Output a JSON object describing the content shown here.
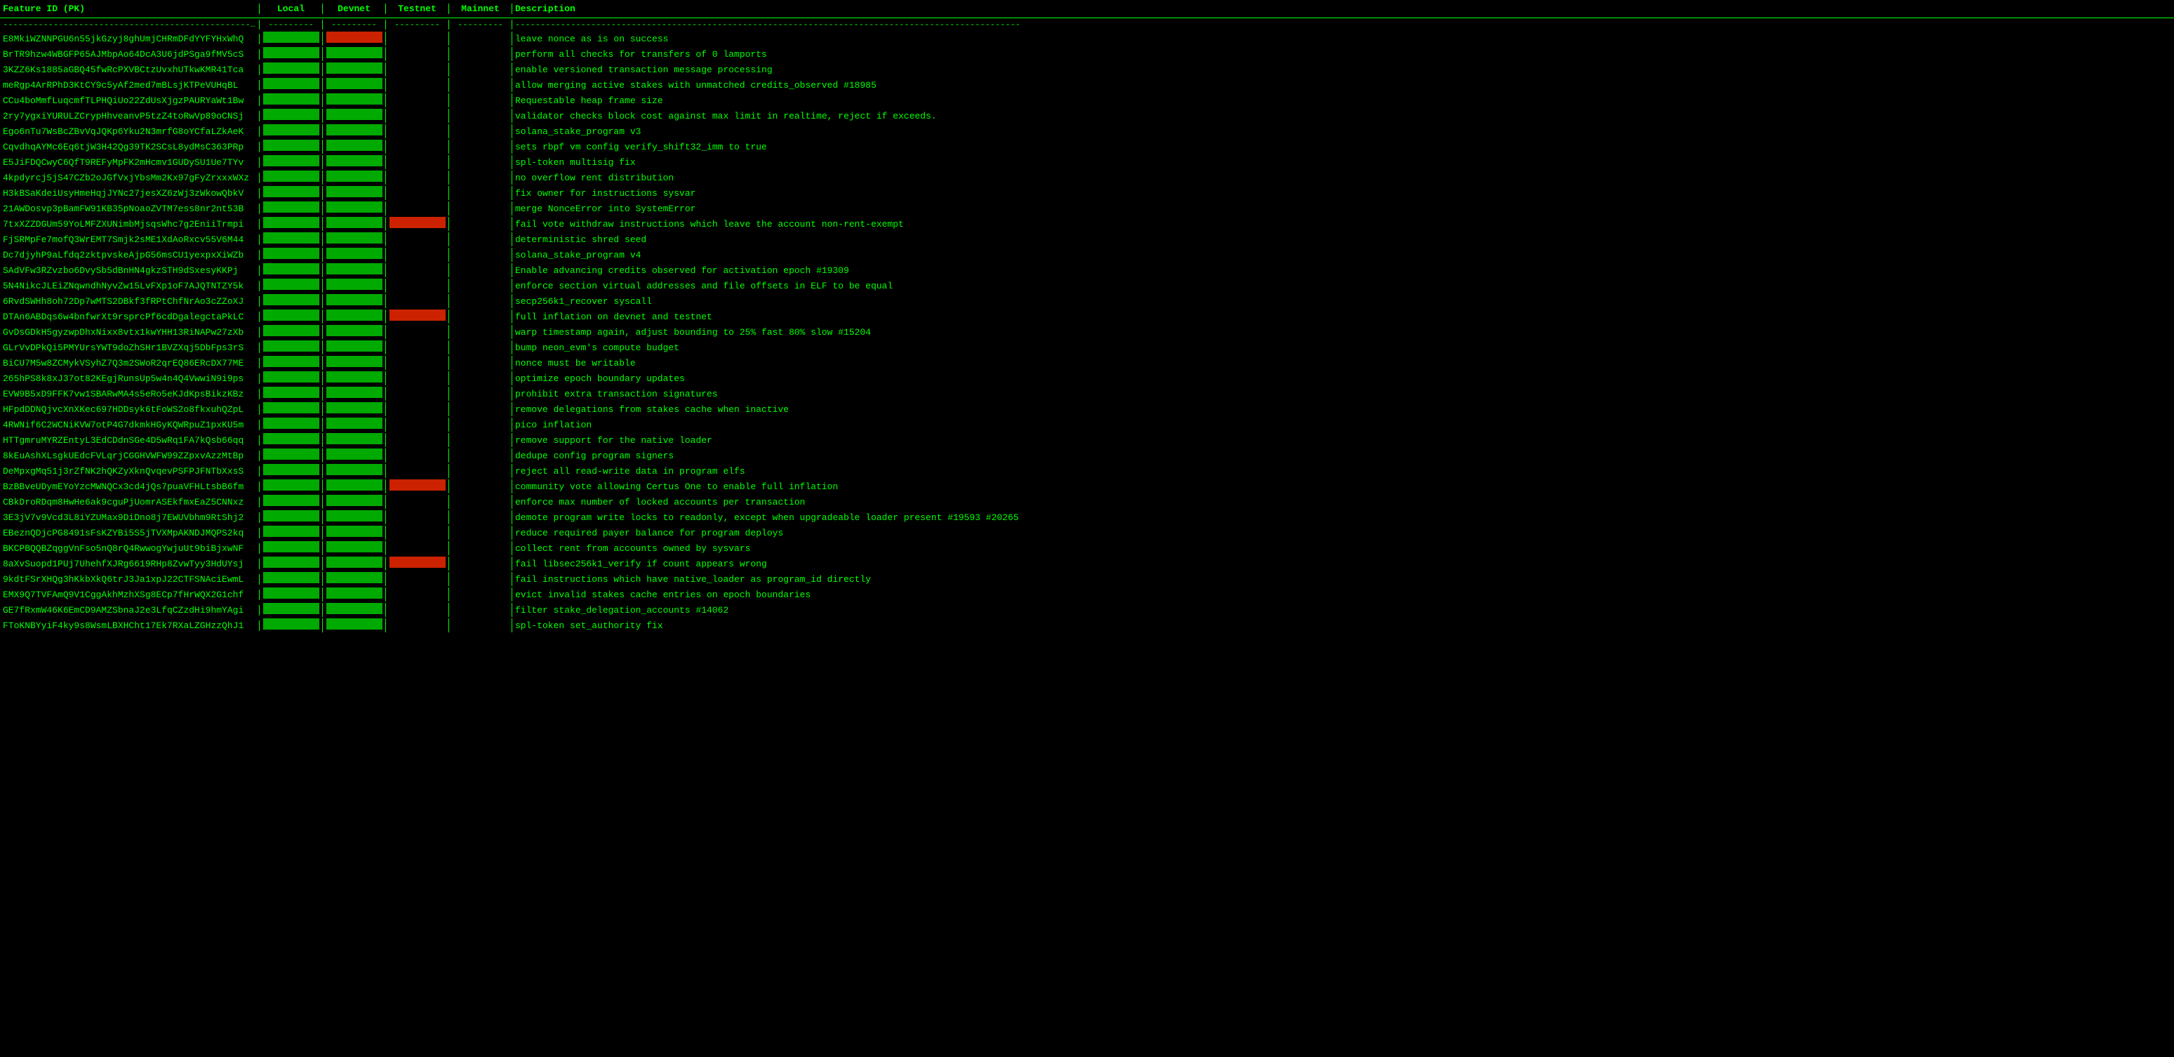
{
  "header": {
    "col_feature": "Feature ID (PK)",
    "col_local": "Local",
    "col_devnet": "Devnet",
    "col_testnet": "Testnet",
    "col_mainnet": "Mainnet",
    "col_description": "Description"
  },
  "rows": [
    {
      "id": "E8MkiWZNNPGU6n55jkGzyj8ghUmjCHRmDFdYYFYHxWhQ",
      "local": "green",
      "devnet": "red",
      "testnet": "empty",
      "mainnet": "empty",
      "desc": "leave nonce as is on success"
    },
    {
      "id": "BrTR9hzw4WBGFP65AJMbpAo64DcA3U6jdPSga9fMV5cS",
      "local": "green",
      "devnet": "green",
      "testnet": "empty",
      "mainnet": "empty",
      "desc": "perform all checks for transfers of 0 lamports"
    },
    {
      "id": "3KZZ6Ks1885aGBQ45fwRcPXVBCtzUvxhUTkwKMR41Tca",
      "local": "green",
      "devnet": "green",
      "testnet": "empty",
      "mainnet": "empty",
      "desc": "enable versioned transaction message processing"
    },
    {
      "id": "meRgp4ArRPhD3KtCY9c5yAf2med7mBLsjKTPeVUHqBL",
      "local": "green",
      "devnet": "green",
      "testnet": "empty",
      "mainnet": "empty",
      "desc": "allow merging active stakes with unmatched credits_observed #18985"
    },
    {
      "id": "CCu4boMmfLuqcmfTLPHQiUo22ZdUsXjgzPAURYaWt1Bw",
      "local": "green",
      "devnet": "green",
      "testnet": "empty",
      "mainnet": "empty",
      "desc": "Requestable heap frame size"
    },
    {
      "id": "2ry7ygxiYURULZCrypHhveanvP5tzZ4toRwVp89oCNSj",
      "local": "green",
      "devnet": "green",
      "testnet": "empty",
      "mainnet": "empty",
      "desc": "validator checks block cost against max limit in realtime, reject if exceeds."
    },
    {
      "id": "Ego6nTu7WsBcZBvVqJQKp6Yku2N3mrfG8oYCfaLZkAeK",
      "local": "green",
      "devnet": "green",
      "testnet": "empty",
      "mainnet": "empty",
      "desc": "solana_stake_program v3"
    },
    {
      "id": "CqvdhqAYMc6Eq6tjW3H42Qg39TK2SCsL8ydMsC363PRp",
      "local": "green",
      "devnet": "green",
      "testnet": "empty",
      "mainnet": "empty",
      "desc": "sets rbpf vm config verify_shift32_imm to true"
    },
    {
      "id": "E5JiFDQCwyC6QfT9REFyMpFK2mHcmv1GUDySU1Ue7TYv",
      "local": "green",
      "devnet": "green",
      "testnet": "empty",
      "mainnet": "empty",
      "desc": "spl-token multisig fix"
    },
    {
      "id": "4kpdyrcj5jS47CZb2oJGfVxjYbsMm2Kx97gFyZrxxxWXz",
      "local": "green",
      "devnet": "green",
      "testnet": "empty",
      "mainnet": "empty",
      "desc": "no overflow rent distribution"
    },
    {
      "id": "H3kBSaKdeiUsyHmeHqjJYNc27jesXZ6zWj3zWkowQbkV",
      "local": "green",
      "devnet": "green",
      "testnet": "empty",
      "mainnet": "empty",
      "desc": "fix owner for instructions sysvar"
    },
    {
      "id": "21AWDosvp3pBamFW91KB35pNoaoZVTM7ess8nr2nt53B",
      "local": "green",
      "devnet": "green",
      "testnet": "empty",
      "mainnet": "empty",
      "desc": "merge NonceError into SystemError"
    },
    {
      "id": "7txXZZDGUm59YoLMFZXUNimbMjsqsWhc7g2EniiTrmpi",
      "local": "green",
      "devnet": "green",
      "testnet": "red",
      "mainnet": "empty",
      "desc": "fail vote withdraw instructions which leave the account non-rent-exempt"
    },
    {
      "id": "FjSRMpFe7mofQ3WrEMT7Smjk2sME1XdAoRxcv55V6M44",
      "local": "green",
      "devnet": "green",
      "testnet": "empty",
      "mainnet": "empty",
      "desc": "deterministic shred seed"
    },
    {
      "id": "Dc7djyhP9aLfdq2zktpvskeAjpG56msCU1yexpxXiWZb",
      "local": "green",
      "devnet": "green",
      "testnet": "empty",
      "mainnet": "empty",
      "desc": "solana_stake_program v4"
    },
    {
      "id": "SAdVFw3RZvzbo6DvySb5dBnHN4gkzSTH9dSxesyKKPj",
      "local": "green",
      "devnet": "green",
      "testnet": "empty",
      "mainnet": "empty",
      "desc": "Enable advancing credits observed for activation epoch #19309"
    },
    {
      "id": "5N4NikcJLEiZNqwndhNyvZw15LvFXp1oF7AJQTNTZY5k",
      "local": "green",
      "devnet": "green",
      "testnet": "empty",
      "mainnet": "empty",
      "desc": "enforce section virtual addresses and file offsets in ELF to be equal"
    },
    {
      "id": "6RvdSWHh8oh72Dp7wMTS2DBkf3fRPtChfNrAo3cZZoXJ",
      "local": "green",
      "devnet": "green",
      "testnet": "empty",
      "mainnet": "empty",
      "desc": "secp256k1_recover syscall"
    },
    {
      "id": "DTAn6ABDqs6w4bnfwrXt9rsprcPf6cdDgalegctaPkLC",
      "local": "green",
      "devnet": "green",
      "testnet": "red",
      "mainnet": "empty",
      "desc": "full inflation on devnet and testnet"
    },
    {
      "id": "GvDsGDkH5gyzwpDhxNixx8vtx1kwYHH13RiNAPw27zXb",
      "local": "green",
      "devnet": "green",
      "testnet": "empty",
      "mainnet": "empty",
      "desc": "warp timestamp again, adjust bounding to 25% fast 80% slow #15204"
    },
    {
      "id": "GLrVvDPkQi5PMYUrsYWT9doZhSHr1BVZXqj5DbFps3rS",
      "local": "green",
      "devnet": "green",
      "testnet": "empty",
      "mainnet": "empty",
      "desc": "bump neon_evm's compute budget"
    },
    {
      "id": "BiCU7M5w8ZCMykVSyhZ7Q3m2SWoR2qrEQ86ERcDX77ME",
      "local": "green",
      "devnet": "green",
      "testnet": "empty",
      "mainnet": "empty",
      "desc": "nonce must be writable"
    },
    {
      "id": "265hPS8k8xJ37ot82KEgjRunsUp5w4n4Q4VwwiN9i9ps",
      "local": "green",
      "devnet": "green",
      "testnet": "empty",
      "mainnet": "empty",
      "desc": "optimize epoch boundary updates"
    },
    {
      "id": "EVW9B5xD9FFK7vw1SBARwMA4s5eRo5eKJdKpsBikzKBz",
      "local": "green",
      "devnet": "green",
      "testnet": "empty",
      "mainnet": "empty",
      "desc": "prohibit extra transaction signatures"
    },
    {
      "id": "HFpdDDNQjvcXnXKec697HDDsyk6tFoWS2o8fkxuhQZpL",
      "local": "green",
      "devnet": "green",
      "testnet": "empty",
      "mainnet": "empty",
      "desc": "remove delegations from stakes cache when inactive"
    },
    {
      "id": "4RWNif6C2WCNiKVW7otP4G7dkmkHGyKQWRpuZ1pxKU5m",
      "local": "green",
      "devnet": "green",
      "testnet": "empty",
      "mainnet": "empty",
      "desc": "pico inflation"
    },
    {
      "id": "HTTgmruMYRZEntyL3EdCDdnSGe4D5wRq1FA7kQsb66qq",
      "local": "green",
      "devnet": "green",
      "testnet": "empty",
      "mainnet": "empty",
      "desc": "remove support for the native loader"
    },
    {
      "id": "8kEuAshXLsgkUEdcFVLqrjCGGHVWFW99ZZpxvAzzMtBp",
      "local": "green",
      "devnet": "green",
      "testnet": "empty",
      "mainnet": "empty",
      "desc": "dedupe config program signers"
    },
    {
      "id": "DeMpxgMq51j3rZfNK2hQKZyXknQvqevPSFPJFNTbXxsS",
      "local": "green",
      "devnet": "green",
      "testnet": "empty",
      "mainnet": "empty",
      "desc": "reject all read-write data in program elfs"
    },
    {
      "id": "BzBBveUDymEYoYzcMWNQCx3cd4jQs7puaVFHLtsbB6fm",
      "local": "green",
      "devnet": "green",
      "testnet": "red",
      "mainnet": "empty",
      "desc": "community vote allowing Certus One to enable full inflation"
    },
    {
      "id": "CBkDroRDqm8HwHe6ak9cguPjUomrASEkfmxEaZ5CNNxz",
      "local": "green",
      "devnet": "green",
      "testnet": "empty",
      "mainnet": "empty",
      "desc": "enforce max number of locked accounts per transaction"
    },
    {
      "id": "3E3jV7v9Vcd3L8iYZUMax9DiDno8j7EWUVbhm9RtShj2",
      "local": "green",
      "devnet": "green",
      "testnet": "empty",
      "mainnet": "empty",
      "desc": "demote program write locks to readonly, except when upgradeable loader present #19593 #20265"
    },
    {
      "id": "EBeznQDjcPG8491sFsKZYBi5S5jTVXMpAKNDJMQPS2kq",
      "local": "green",
      "devnet": "green",
      "testnet": "empty",
      "mainnet": "empty",
      "desc": "reduce required payer balance for program deploys"
    },
    {
      "id": "BKCPBQQBZqggVnFso5nQ8rQ4RwwogYwjuUt9biBjxwNF",
      "local": "green",
      "devnet": "green",
      "testnet": "empty",
      "mainnet": "empty",
      "desc": "collect rent from accounts owned by sysvars"
    },
    {
      "id": "8aXvSuopd1PUj7UhehfXJRg6619RHp8ZvwTyy3HdUYsj",
      "local": "green",
      "devnet": "green",
      "testnet": "red",
      "mainnet": "empty",
      "desc": "fail libsec256k1_verify if count appears wrong"
    },
    {
      "id": "9kdtFSrXHQg3hKkbXkQ6trJ3Ja1xpJ22CTFSNAciEwmL",
      "local": "green",
      "devnet": "green",
      "testnet": "empty",
      "mainnet": "empty",
      "desc": "fail instructions which have native_loader as program_id directly"
    },
    {
      "id": "EMX9Q7TVFAmQ9V1CggAkhMzhXSg8ECp7fHrWQX2G1chf",
      "local": "green",
      "devnet": "green",
      "testnet": "empty",
      "mainnet": "empty",
      "desc": "evict invalid stakes cache entries on epoch boundaries"
    },
    {
      "id": "GE7fRxmW46K6EmCD9AMZSbnaJ2e3LfqCZzdHi9hmYAgi",
      "local": "green",
      "devnet": "green",
      "testnet": "empty",
      "mainnet": "empty",
      "desc": "filter stake_delegation_accounts #14062"
    },
    {
      "id": "FToKNBYyiF4ky9s8WsmLBXHCht17Ek7RXaLZGHzzQhJ1",
      "local": "green",
      "devnet": "green",
      "testnet": "empty",
      "mainnet": "empty",
      "desc": "spl-token set_authority fix"
    }
  ]
}
